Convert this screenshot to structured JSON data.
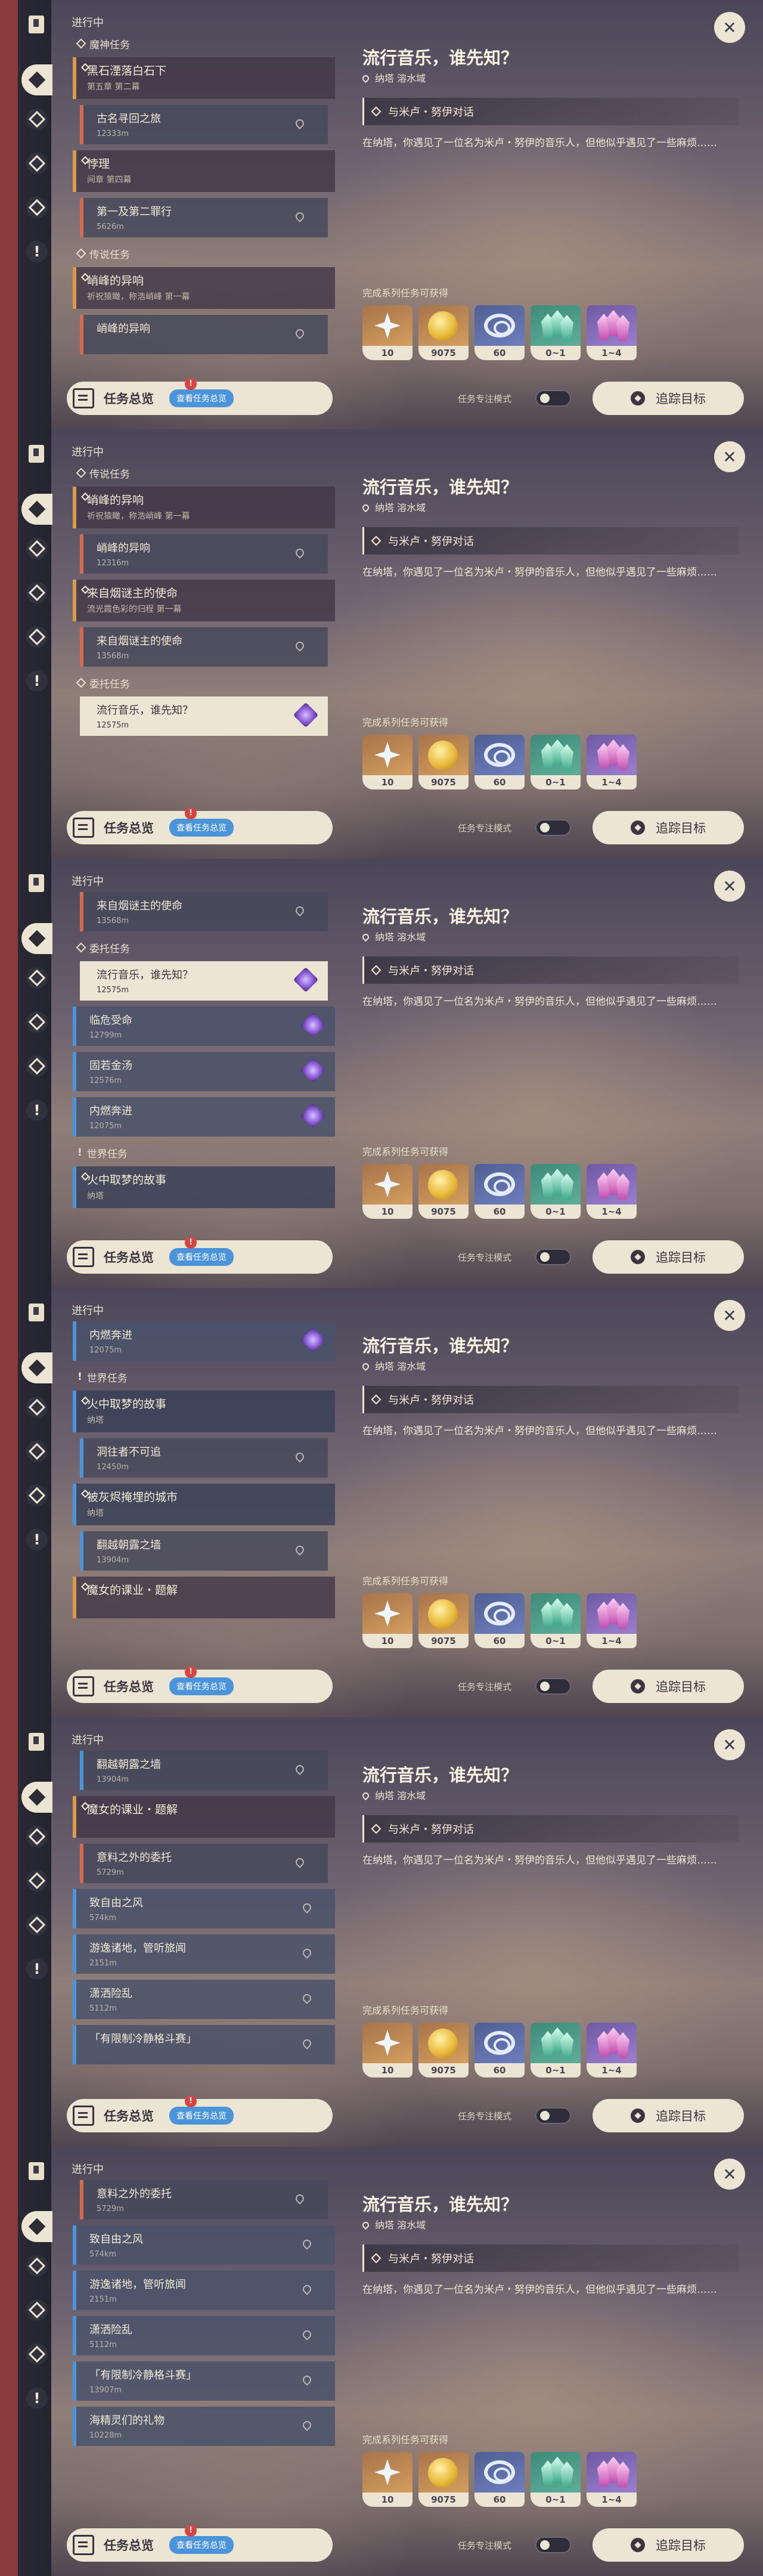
{
  "common": {
    "in_progress": "进行中",
    "overview_title": "任务总览",
    "overview_link": "查看任务总览",
    "badge": "!",
    "close": "✕",
    "toggle_label": "任务专注模式",
    "track_label": "追踪目标"
  },
  "detail": {
    "title": "流行音乐，谁先知？",
    "location": "纳塔 溶水域",
    "step": "与米卢・努伊对话",
    "description": "在纳塔，你遇见了一位名为米卢・努伊的音乐人，但他似乎遇见了一些麻烦……",
    "rewards_label": "完成系列任务可获得",
    "rewards": [
      {
        "icon": "star-dust-icon",
        "count": "10",
        "rarity": "orange"
      },
      {
        "icon": "mora-coin-icon",
        "count": "9075",
        "rarity": "orange"
      },
      {
        "icon": "exp-swirl-icon",
        "count": "60",
        "rarity": "blue"
      },
      {
        "icon": "crystal-green-icon",
        "count": "0~1",
        "rarity": "green"
      },
      {
        "icon": "crystal-purple-icon",
        "count": "1~4",
        "rarity": "purple"
      }
    ]
  },
  "screens": [
    {
      "items": [
        {
          "kind": "section",
          "icon": "diamond",
          "label": "魔神任务"
        },
        {
          "kind": "quest",
          "title": "黑石湮落白石下",
          "sub": "第五章 第二幕",
          "color": "orange"
        },
        {
          "kind": "sub",
          "title": "古名寻回之旅",
          "sub": "12333m",
          "color": "red"
        },
        {
          "kind": "quest",
          "title": "悖理",
          "sub": "间章 第四幕",
          "color": "orange"
        },
        {
          "kind": "sub",
          "title": "第一及第二罪行",
          "sub": "5626m",
          "color": "red"
        },
        {
          "kind": "section",
          "icon": "diamond",
          "label": "传说任务"
        },
        {
          "kind": "quest",
          "title": "峭峰的异响",
          "sub": "祈祝猿瞰，称浩峭峰 第一幕",
          "color": "orange"
        },
        {
          "kind": "sub",
          "title": "峭峰的异响",
          "sub": "",
          "color": "red"
        }
      ],
      "show_close_badge": true
    },
    {
      "items": [
        {
          "kind": "section",
          "icon": "diamond",
          "label": "传说任务"
        },
        {
          "kind": "quest",
          "title": "峭峰的异响",
          "sub": "祈祝猿瞰，称浩峭峰 第一幕",
          "color": "orange"
        },
        {
          "kind": "sub",
          "title": "峭峰的异响",
          "sub": "12316m",
          "color": "red"
        },
        {
          "kind": "quest",
          "title": "来自烟谜主的使命",
          "sub": "流光霞色彩的归程 第一幕",
          "color": "orange"
        },
        {
          "kind": "sub",
          "title": "来自烟谜主的使命",
          "sub": "13568m",
          "color": "red"
        },
        {
          "kind": "section",
          "icon": "diamond",
          "label": "委托任务"
        },
        {
          "kind": "selected",
          "title": "流行音乐，谁先知？",
          "sub": "12575m"
        }
      ]
    },
    {
      "items": [
        {
          "kind": "sub",
          "title": "来自烟谜主的使命",
          "sub": "13568m",
          "color": "red"
        },
        {
          "kind": "section",
          "icon": "diamond",
          "label": "委托任务"
        },
        {
          "kind": "selected",
          "title": "流行音乐，谁先知？",
          "sub": "12575m"
        },
        {
          "kind": "gemrow",
          "title": "临危受命",
          "sub": "12799m"
        },
        {
          "kind": "gemrow",
          "title": "固若金汤",
          "sub": "12576m"
        },
        {
          "kind": "gemrow",
          "title": "内燃奔进",
          "sub": "12075m"
        },
        {
          "kind": "section",
          "icon": "excl",
          "label": "世界任务"
        },
        {
          "kind": "quest",
          "title": "火中取梦的故事",
          "sub": "纳塔",
          "color": "blue"
        }
      ]
    },
    {
      "items": [
        {
          "kind": "gemrow",
          "title": "内燃奔进",
          "sub": "12075m"
        },
        {
          "kind": "section",
          "icon": "excl",
          "label": "世界任务"
        },
        {
          "kind": "quest",
          "title": "火中取梦的故事",
          "sub": "纳塔",
          "color": "blue"
        },
        {
          "kind": "sub",
          "title": "洞往者不可追",
          "sub": "12450m",
          "color": "blue"
        },
        {
          "kind": "quest",
          "title": "被灰烬掩埋的城市",
          "sub": "纳塔",
          "color": "blue"
        },
        {
          "kind": "sub",
          "title": "翻越朝露之墙",
          "sub": "13904m",
          "color": "blue"
        },
        {
          "kind": "quest",
          "title": "魔女的课业・题解",
          "sub": "",
          "color": "orange"
        }
      ]
    },
    {
      "items": [
        {
          "kind": "sub",
          "title": "翻越朝露之墙",
          "sub": "13904m",
          "color": "blue"
        },
        {
          "kind": "quest",
          "title": "魔女的课业・题解",
          "sub": "",
          "color": "orange"
        },
        {
          "kind": "sub",
          "title": "意料之外的委托",
          "sub": "5729m",
          "color": "red"
        },
        {
          "kind": "white",
          "title": "致自由之风",
          "sub": "574km"
        },
        {
          "kind": "white",
          "title": "游逸诸地，管听旅闻",
          "sub": "2151m"
        },
        {
          "kind": "white",
          "title": "潇洒险乱",
          "sub": "5112m"
        },
        {
          "kind": "white",
          "title": "「有限制冷静格斗赛」",
          "sub": ""
        }
      ]
    },
    {
      "items": [
        {
          "kind": "sub",
          "title": "意料之外的委托",
          "sub": "5729m",
          "color": "red"
        },
        {
          "kind": "white",
          "title": "致自由之风",
          "sub": "574km"
        },
        {
          "kind": "white",
          "title": "游逸诸地，管听旅闻",
          "sub": "2151m"
        },
        {
          "kind": "white",
          "title": "潇洒险乱",
          "sub": "5112m"
        },
        {
          "kind": "white",
          "title": "「有限制冷静格斗赛」",
          "sub": "13907m"
        },
        {
          "kind": "white",
          "title": "海精灵们的礼物",
          "sub": "10228m"
        }
      ]
    }
  ]
}
